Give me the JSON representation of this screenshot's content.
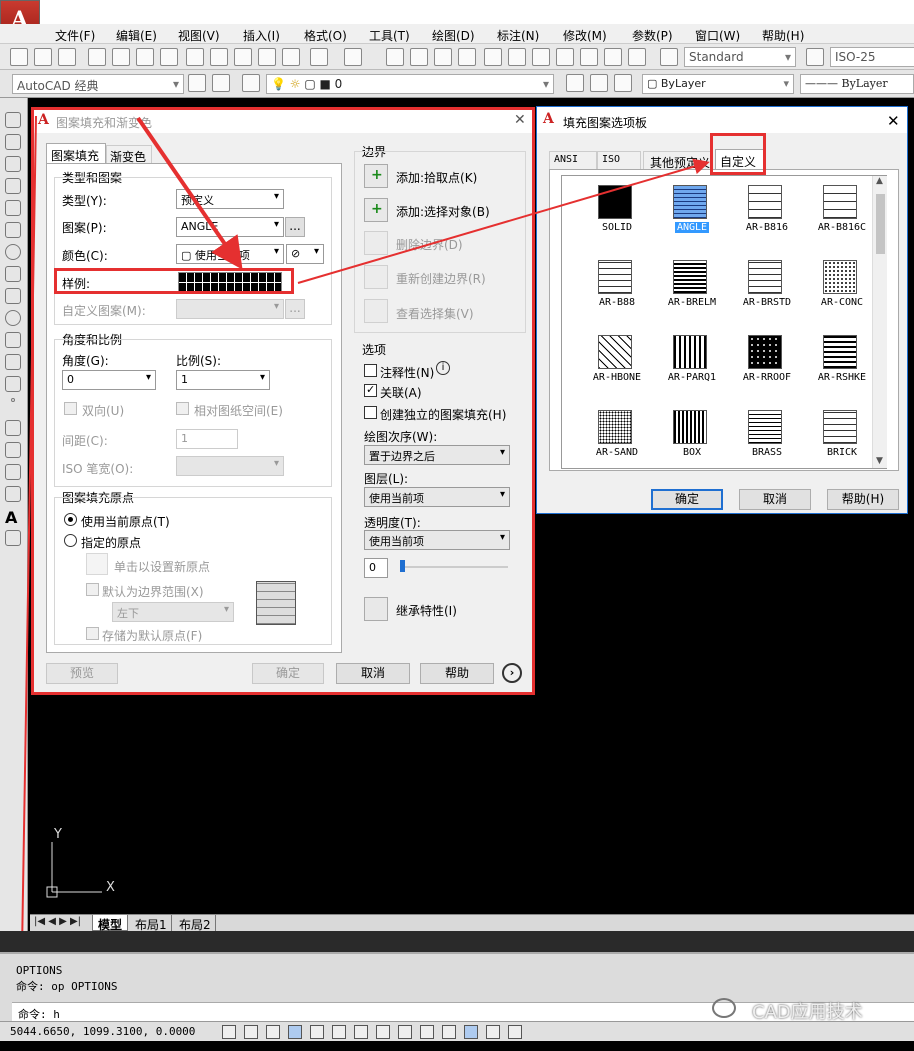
{
  "app": {
    "logo": "A"
  },
  "menu": [
    "文件(F)",
    "编辑(E)",
    "视图(V)",
    "插入(I)",
    "格式(O)",
    "工具(T)",
    "绘图(D)",
    "标注(N)",
    "修改(M)",
    "参数(P)",
    "窗口(W)",
    "帮助(H)"
  ],
  "toolbar": {
    "text_style": "Standard",
    "dim_style": "ISO-25",
    "workspace": "AutoCAD 经典",
    "layer_value": "0",
    "bylayer_color": "ByLayer",
    "bylayer_linetype": "ByLayer"
  },
  "hatch": {
    "title": "图案填充和渐变色",
    "tabs": [
      "图案填充",
      "渐变色"
    ],
    "type_group": "类型和图案",
    "type_label": "类型(Y):",
    "type_value": "预定义",
    "pattern_label": "图案(P):",
    "pattern_value": "ANGLE",
    "dots": "...",
    "color_label": "颜色(C):",
    "color_value": "使用当前项",
    "sample_label": "样例:",
    "custom_label": "自定义图案(M):",
    "angle_group": "角度和比例",
    "angle_label": "角度(G):",
    "angle_value": "0",
    "scale_label": "比例(S):",
    "scale_value": "1",
    "double_label": "双向(U)",
    "relative_label": "相对图纸空间(E)",
    "spacing_label": "间距(C):",
    "spacing_value": "1",
    "iso_label": "ISO 笔宽(O):",
    "origin_group": "图案填充原点",
    "use_current": "使用当前原点(T)",
    "specified": "指定的原点",
    "click_set": "单击以设置新原点",
    "default_bound": "默认为边界范围(X)",
    "position_value": "左下",
    "store_default": "存储为默认原点(F)",
    "boundary_group": "边界",
    "add_pick": "添加:拾取点(K)",
    "add_select": "添加:选择对象(B)",
    "remove_boundary": "删除边界(D)",
    "recreate_boundary": "重新创建边界(R)",
    "view_selection": "查看选择集(V)",
    "options_group": "选项",
    "annotative": "注释性(N)",
    "associative": "关联(A)",
    "independent": "创建独立的图案填充(H)",
    "draw_order_label": "绘图次序(W):",
    "draw_order_value": "置于边界之后",
    "layer_label": "图层(L):",
    "layer_value": "使用当前项",
    "transparency_label": "透明度(T):",
    "transparency_value": "使用当前项",
    "transparency_num": "0",
    "inherit": "继承特性(I)",
    "preview_btn": "预览",
    "ok_btn": "确定",
    "cancel_btn": "取消",
    "help_btn": "帮助"
  },
  "palette": {
    "title": "填充图案选项板",
    "tabs": [
      "ANSI",
      "ISO",
      "其他预定义",
      "自定义"
    ],
    "items": [
      "SOLID",
      "ANGLE",
      "AR-B816",
      "AR-B816C",
      "AR-B88",
      "AR-BRELM",
      "AR-BRSTD",
      "AR-CONC",
      "AR-HBONE",
      "AR-PARQ1",
      "AR-RROOF",
      "AR-RSHKE",
      "AR-SAND",
      "BOX",
      "BRASS",
      "BRICK"
    ],
    "selected": "ANGLE",
    "ok_btn": "确定",
    "cancel_btn": "取消",
    "help_btn": "帮助(H)"
  },
  "ucs": {
    "y": "Y",
    "x": "X"
  },
  "layout_tabs": [
    "模型",
    "布局1",
    "布局2"
  ],
  "command": {
    "lines": [
      "OPTIONS",
      "命令: op OPTIONS"
    ],
    "prompt": "命令: h"
  },
  "status": {
    "coords": "5044.6650, 1099.3100, 0.0000"
  },
  "watermark": "CAD应用技术",
  "colors": {
    "highlight": "#e53030",
    "selection": "#3399ff"
  }
}
